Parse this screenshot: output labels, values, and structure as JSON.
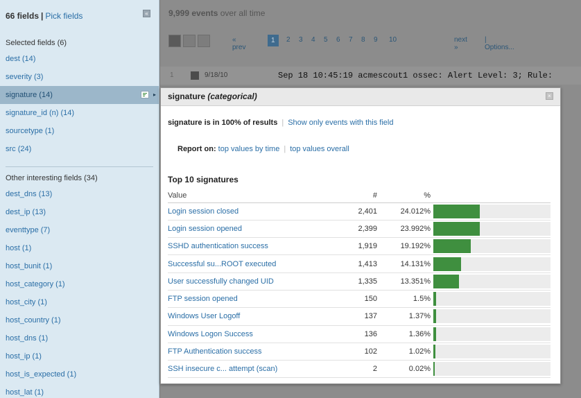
{
  "sidebar": {
    "field_count": "66 fields",
    "separator": "|",
    "pick_fields": "Pick fields",
    "selected_header": "Selected fields (6)",
    "selected_fields": [
      {
        "label": "dest (14)"
      },
      {
        "label": "severity (3)"
      },
      {
        "label": "signature (14)"
      },
      {
        "label": "signature_id (n) (14)"
      },
      {
        "label": "sourcetype (1)"
      },
      {
        "label": "src (24)"
      }
    ],
    "other_header": "Other interesting fields (34)",
    "other_fields": [
      {
        "label": "dest_dns (13)"
      },
      {
        "label": "dest_ip (13)"
      },
      {
        "label": "eventtype (7)"
      },
      {
        "label": "host (1)"
      },
      {
        "label": "host_bunit (1)"
      },
      {
        "label": "host_category (1)"
      },
      {
        "label": "host_city (1)"
      },
      {
        "label": "host_country (1)"
      },
      {
        "label": "host_dns (1)"
      },
      {
        "label": "host_ip (1)"
      },
      {
        "label": "host_is_expected (1)"
      },
      {
        "label": "host_lat (1)"
      }
    ]
  },
  "main": {
    "events_bold": "9,999 events",
    "events_rest": " over all time",
    "pager": {
      "prev": "« prev",
      "pages": [
        "1",
        "2",
        "3",
        "4",
        "5",
        "6",
        "7",
        "8",
        "9",
        "10"
      ],
      "current": "1",
      "next": "next »",
      "options": "| Options..."
    },
    "event": {
      "num": "1",
      "date": "9/18/10",
      "raw": "Sep 18 10:45:19 acmescout1 ossec: Alert Level: 3; Rule:"
    }
  },
  "popup": {
    "title": "signature",
    "title_type": "(categorical)",
    "pct_text": "signature is in 100% of results",
    "pct_sep": "|",
    "show_only": "Show only events with this field",
    "report_label": "Report on:",
    "report_by_time": "top values by time",
    "report_sep": "|",
    "report_overall": "top values overall",
    "top_title": "Top 10 signatures",
    "col_value": "Value",
    "col_count": "#",
    "col_pct": "%",
    "rows": [
      {
        "value": "Login session closed",
        "count": "2,401",
        "pct": "24.012%",
        "fraction": 0.24012
      },
      {
        "value": "Login session opened",
        "count": "2,399",
        "pct": "23.992%",
        "fraction": 0.23992
      },
      {
        "value": "SSHD authentication success",
        "count": "1,919",
        "pct": "19.192%",
        "fraction": 0.19192
      },
      {
        "value": "Successful su...ROOT executed",
        "count": "1,413",
        "pct": "14.131%",
        "fraction": 0.14131
      },
      {
        "value": "User successfully changed UID",
        "count": "1,335",
        "pct": "13.351%",
        "fraction": 0.13351
      },
      {
        "value": "FTP session opened",
        "count": "150",
        "pct": "1.5%",
        "fraction": 0.015
      },
      {
        "value": "Windows User Logoff",
        "count": "137",
        "pct": "1.37%",
        "fraction": 0.0137
      },
      {
        "value": "Windows Logon Success",
        "count": "136",
        "pct": "1.36%",
        "fraction": 0.0136
      },
      {
        "value": "FTP Authentication success",
        "count": "102",
        "pct": "1.02%",
        "fraction": 0.0102
      },
      {
        "value": "SSH insecure c... attempt (scan)",
        "count": "2",
        "pct": "0.02%",
        "fraction": 0.0002
      }
    ]
  },
  "colors": {
    "sidebar_bg": "#dbe9f2",
    "selected_bg": "#9cb7ca",
    "link": "#2a6ea6",
    "bar_fill": "#3f8f3f",
    "bar_track": "#ececec"
  }
}
